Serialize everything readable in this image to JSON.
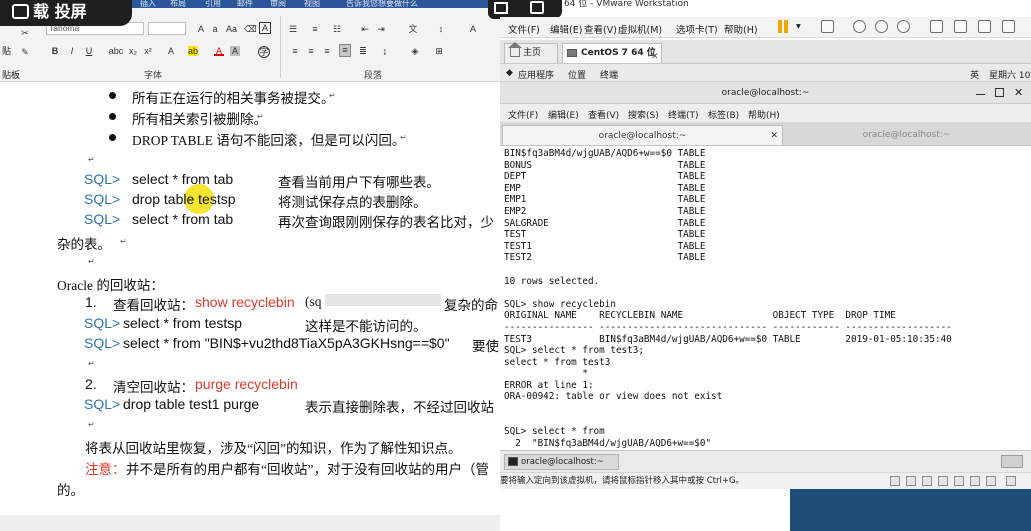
{
  "recording": {
    "label": "载 投屏"
  },
  "ribbon": {
    "tabs": [
      "插入",
      "布局",
      "引用",
      "邮件",
      "审阅",
      "视图",
      "告诉我您想要做什么"
    ],
    "font_name": "Tahoma",
    "paste_label": "贴",
    "clipboard_label": "贴板",
    "font_group_label": "字体",
    "paragraph_group_label": "段落"
  },
  "document": {
    "bullets": [
      "所有正在运行的相关事务被提交。",
      "所有相关索引被删除。",
      "DROP TABLE 语句不能回滚，但是可以闪回。"
    ],
    "sql_lines": [
      {
        "prompt": "SQL>",
        "cmd": "select * from tab",
        "desc": "查看当前用户下有哪些表。"
      },
      {
        "prompt": "SQL>",
        "cmd": "drop table testsp",
        "desc": "将测试保存点的表删除。"
      },
      {
        "prompt": "SQL>",
        "cmd": "select * from tab",
        "desc": "再次查询跟刚刚保存的表名比对，少"
      }
    ],
    "continuation": "杂的表。",
    "recycle_heading": "Oracle 的回收站：",
    "item1_num": "1.",
    "item1_text": "查看回收站：",
    "item1_cmd": "show recyclebin",
    "item1_tail_a": "(sq",
    "item1_tail_b": "复杂的命",
    "sql2_1": {
      "prompt": "SQL>",
      "cmd": "select * from testsp",
      "desc": "这样是不能访问的。"
    },
    "sql2_2": {
      "prompt": "SQL>",
      "cmd": "select * from \"BIN$+vu2thd8TiaX5pA3GKHsng==$0\"",
      "desc": "要使"
    },
    "item2_num": "2.",
    "item2_text": "清空回收站：",
    "item2_cmd": "purge recyclebin",
    "sql2_3": {
      "prompt": "SQL>",
      "cmd": "drop table test1 purge",
      "desc": "表示直接删除表，不经过回收站"
    },
    "flash_note": "将表从回收站里恢复，涉及“闪回”的知识，作为了解性知识点。",
    "note_label": "注意：",
    "note_text": "并不是所有的用户都有“回收站”，对于没有回收站的用户（管",
    "note_end": "的。"
  },
  "vmware": {
    "title": "64 位 - VMware Workstation",
    "menu": [
      "文件(F)",
      "编辑(E)",
      "查看(V)",
      "虚拟机(M)",
      "选项卡(T)",
      "帮助(H)"
    ],
    "tabs": [
      {
        "label": "主页",
        "active": false
      },
      {
        "label": "CentOS 7 64 位",
        "active": true
      }
    ],
    "gnome": {
      "apps": "应用程序",
      "places": "位置",
      "terminal": "终端",
      "lang": "英",
      "clock": "星期六 10"
    },
    "terminal_title": "oracle@localhost:~",
    "terminal_menu": [
      "文件(F)",
      "编辑(E)",
      "查看(V)",
      "搜索(S)",
      "终端(T)",
      "标签(B)",
      "帮助(H)"
    ],
    "terminal_tabs": [
      "oracle@localhost:~",
      "oracle@localhost:~"
    ],
    "terminal_lines": [
      "BIN$fq3aBM4d/wjgUAB/AQD6+w==$0 TABLE",
      "BONUS                          TABLE",
      "DEPT                           TABLE",
      "EMP                            TABLE",
      "EMP1                           TABLE",
      "EMP2                           TABLE",
      "SALGRADE                       TABLE",
      "TEST                           TABLE",
      "TEST1                          TABLE",
      "TEST2                          TABLE",
      "",
      "10 rows selected.",
      "",
      "SQL> show recyclebin",
      "ORIGINAL NAME    RECYCLEBIN NAME                OBJECT TYPE  DROP TIME",
      "---------------- ------------------------------ ------------ -------------------",
      "TEST3            BIN$fq3aBM4d/wjgUAB/AQD6+w==$0 TABLE        2019-01-05:10:35:40",
      "SQL> select * from test3;",
      "select * from test3",
      "              *",
      "ERROR at line 1:",
      "ORA-00942: table or view does not exist",
      "",
      "",
      "SQL> select * from",
      "  2  \"BIN$fq3aBM4d/wjgUAB/AQD6+w==$0\""
    ],
    "taskbar_item": "oracle@localhost:~",
    "status_text": "要将输入定向到该虚拟机，请将鼠标指针移入其中或按 Ctrl+G。"
  }
}
